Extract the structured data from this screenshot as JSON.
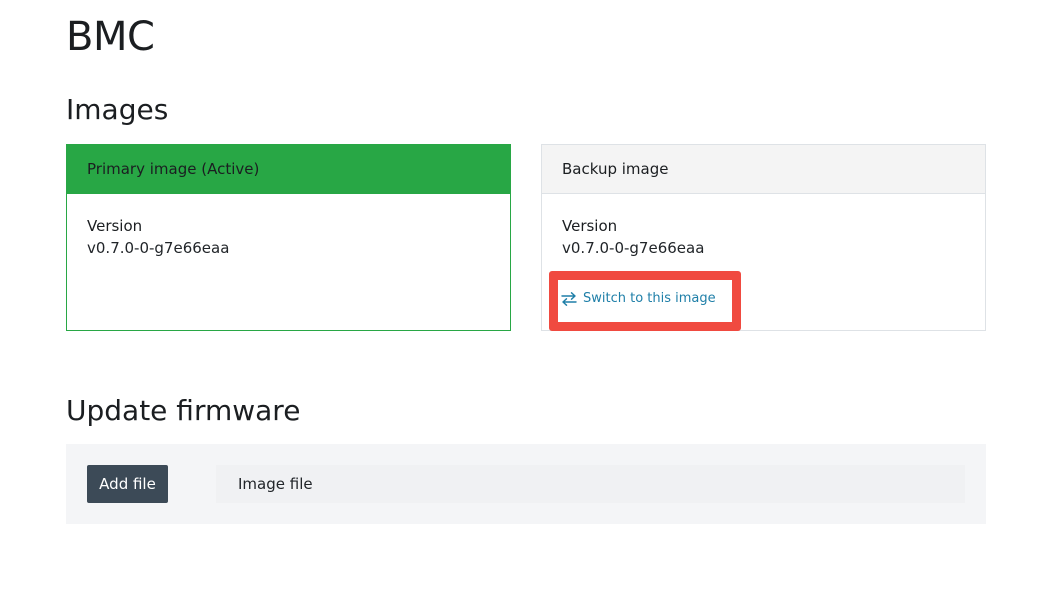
{
  "page": {
    "title": "BMC"
  },
  "images": {
    "section_title": "Images",
    "primary": {
      "header": "Primary image (Active)",
      "version_label": "Version",
      "version_value": "v0.7.0-0-g7e66eaa"
    },
    "backup": {
      "header": "Backup image",
      "version_label": "Version",
      "version_value": "v0.7.0-0-g7e66eaa",
      "switch_label": "Switch to this image",
      "switch_icon": "switch-arrows-icon"
    }
  },
  "update_firmware": {
    "section_title": "Update firmware",
    "add_file_label": "Add file",
    "file_placeholder": "Image file"
  },
  "colors": {
    "active_green": "#28a745",
    "highlight_red": "#f04a40",
    "link_blue": "#1f7fa8",
    "button_dark": "#3c4a57"
  }
}
